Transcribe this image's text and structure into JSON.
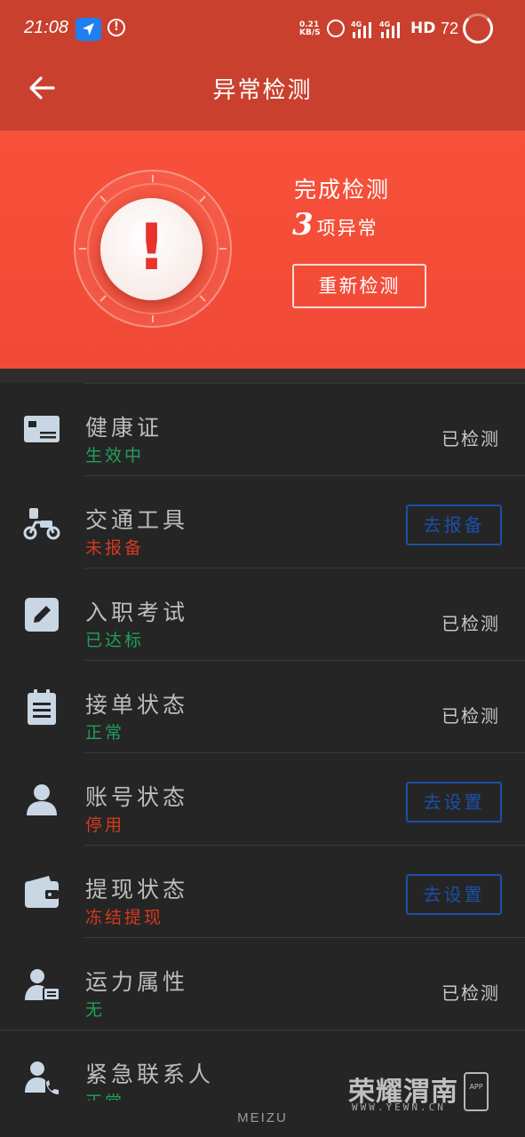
{
  "status_bar": {
    "time": "21:08",
    "net_speed_value": "0.21",
    "net_speed_unit": "KB/S",
    "network_1": "4G",
    "network_2": "4G",
    "hd_label": "HD",
    "battery": "72"
  },
  "header": {
    "title": "异常检测",
    "back_icon": "arrow-left-icon"
  },
  "hero": {
    "line1": "完成检测",
    "count": "3",
    "count_suffix": "项异常",
    "recheck_label": "重新检测",
    "alert_icon": "exclamation-icon"
  },
  "items": [
    {
      "title": "健康证",
      "sub": "生效中",
      "sub_state": "ok",
      "right_text": "已检测",
      "icon": "id-card-icon"
    },
    {
      "title": "交通工具",
      "sub": "未报备",
      "sub_state": "bad",
      "button": "去报备",
      "icon": "scooter-icon"
    },
    {
      "title": "入职考试",
      "sub": "已达标",
      "sub_state": "ok",
      "right_text": "已检测",
      "icon": "edit-icon"
    },
    {
      "title": "接单状态",
      "sub": "正常",
      "sub_state": "ok",
      "right_text": "已检测",
      "icon": "clipboard-icon"
    },
    {
      "title": "账号状态",
      "sub": "停用",
      "sub_state": "bad",
      "button": "去设置",
      "icon": "user-icon"
    },
    {
      "title": "提现状态",
      "sub": "冻结提现",
      "sub_state": "bad",
      "button": "去设置",
      "icon": "wallet-icon"
    },
    {
      "title": "运力属性",
      "sub": "无",
      "sub_state": "ok",
      "right_text": "已检测",
      "icon": "user-card-icon"
    },
    {
      "title": "紧急联系人",
      "sub": "正常",
      "sub_state": "ok",
      "icon": "user-phone-icon"
    }
  ],
  "colors": {
    "header_bg": "#c9412e",
    "hero_bg": "#f04a37",
    "ok": "#1fa15a",
    "bad": "#d43a1f",
    "action": "#1c4fa8"
  },
  "watermark": {
    "text": "荣耀渭南",
    "sub": "WWW.YEWN.CN",
    "app_label": "APP"
  },
  "device_brand": "MEIZU"
}
